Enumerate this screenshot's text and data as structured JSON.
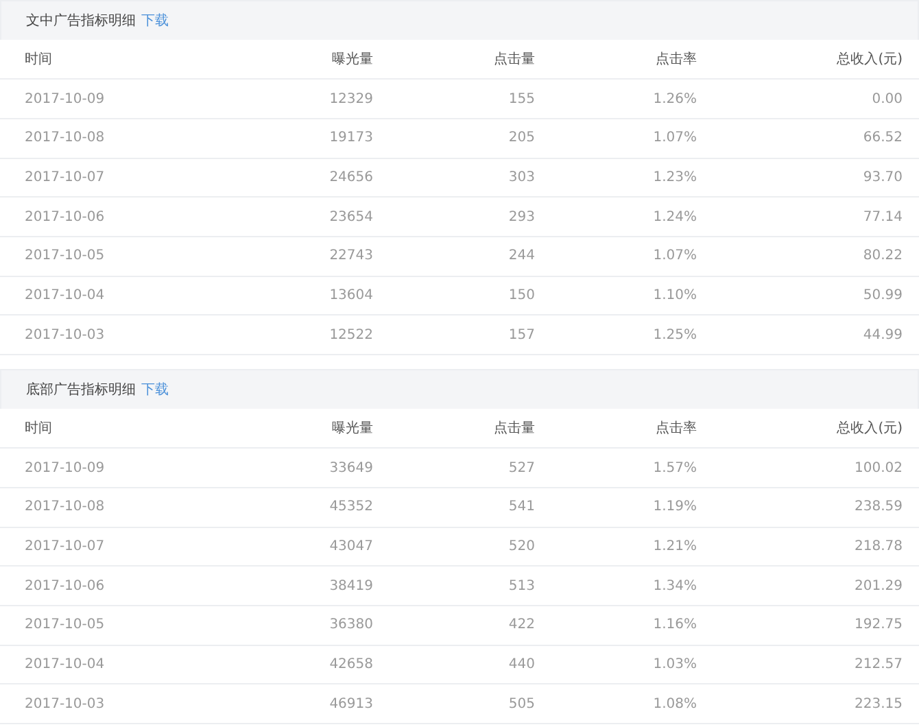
{
  "sections": [
    {
      "title": "文中广告指标明细",
      "link": "下载",
      "columns": [
        "时间",
        "曝光量",
        "点击量",
        "点击率",
        "总收入(元)"
      ],
      "rows": [
        [
          "2017-10-09",
          "12329",
          "155",
          "1.26%",
          "0.00"
        ],
        [
          "2017-10-08",
          "19173",
          "205",
          "1.07%",
          "66.52"
        ],
        [
          "2017-10-07",
          "24656",
          "303",
          "1.23%",
          "93.70"
        ],
        [
          "2017-10-06",
          "23654",
          "293",
          "1.24%",
          "77.14"
        ],
        [
          "2017-10-05",
          "22743",
          "244",
          "1.07%",
          "80.22"
        ],
        [
          "2017-10-04",
          "13604",
          "150",
          "1.10%",
          "50.99"
        ],
        [
          "2017-10-03",
          "12522",
          "157",
          "1.25%",
          "44.99"
        ]
      ]
    },
    {
      "title": "底部广告指标明细",
      "link": "下载",
      "columns": [
        "时间",
        "曝光量",
        "点击量",
        "点击率",
        "总收入(元)"
      ],
      "rows": [
        [
          "2017-10-09",
          "33649",
          "527",
          "1.57%",
          "100.02"
        ],
        [
          "2017-10-08",
          "45352",
          "541",
          "1.19%",
          "238.59"
        ],
        [
          "2017-10-07",
          "43047",
          "520",
          "1.21%",
          "218.78"
        ],
        [
          "2017-10-06",
          "38419",
          "513",
          "1.34%",
          "201.29"
        ],
        [
          "2017-10-05",
          "36380",
          "422",
          "1.16%",
          "192.75"
        ],
        [
          "2017-10-04",
          "42658",
          "440",
          "1.03%",
          "212.57"
        ],
        [
          "2017-10-03",
          "46913",
          "505",
          "1.08%",
          "223.15"
        ]
      ]
    }
  ]
}
